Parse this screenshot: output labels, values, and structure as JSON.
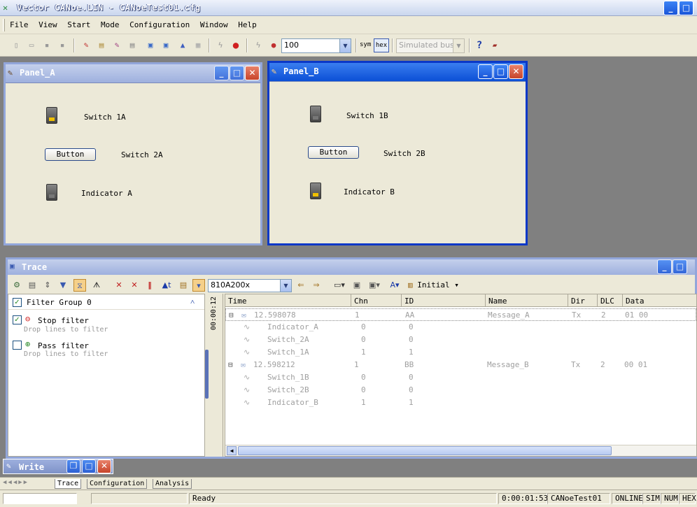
{
  "window": {
    "title": "Vector CANoe.LIN  - CANoeTest01.cfg"
  },
  "menu": [
    "File",
    "View",
    "Start",
    "Mode",
    "Configuration",
    "Window",
    "Help"
  ],
  "toolbar": {
    "zoom": "100",
    "sym": "sym",
    "hex": "hex",
    "bus": "Simulated bus"
  },
  "panel_a": {
    "title": "Panel_A",
    "switch1": "Switch 1A",
    "button": "Button",
    "switch2": "Switch 2A",
    "indicator": "Indicator A"
  },
  "panel_b": {
    "title": "Panel_B",
    "switch1": "Switch 1B",
    "button": "Button",
    "switch2": "Switch 2B",
    "indicator": "Indicator B"
  },
  "trace": {
    "title": "Trace",
    "filter_value": "810A200x",
    "view_mode": "Initial",
    "time_scale": "00:00:12",
    "filter_group": "Filter Group 0",
    "stop_filter": "Stop filter",
    "stop_hint": "Drop lines to filter",
    "pass_filter": "Pass filter",
    "pass_hint": "Drop lines to filter",
    "columns": [
      "Time",
      "Chn",
      "ID",
      "Name",
      "Dir",
      "DLC",
      "Data"
    ],
    "rows": [
      {
        "time": "12.598078",
        "chn": "1",
        "id": "AA",
        "name": "Message_A",
        "dir": "Tx",
        "dlc": "2",
        "data": "01 00"
      },
      {
        "time": "Indicator_A",
        "chn": "0",
        "id": "0",
        "name": "",
        "dir": "",
        "dlc": "",
        "data": ""
      },
      {
        "time": "Switch_2A",
        "chn": "0",
        "id": "0",
        "name": "",
        "dir": "",
        "dlc": "",
        "data": ""
      },
      {
        "time": "Switch_1A",
        "chn": "1",
        "id": "1",
        "name": "",
        "dir": "",
        "dlc": "",
        "data": ""
      },
      {
        "time": "12.598212",
        "chn": "1",
        "id": "BB",
        "name": "Message_B",
        "dir": "Tx",
        "dlc": "2",
        "data": "00 01"
      },
      {
        "time": "Switch_1B",
        "chn": "0",
        "id": "0",
        "name": "",
        "dir": "",
        "dlc": "",
        "data": ""
      },
      {
        "time": "Switch_2B",
        "chn": "0",
        "id": "0",
        "name": "",
        "dir": "",
        "dlc": "",
        "data": ""
      },
      {
        "time": "Indicator_B",
        "chn": "1",
        "id": "1",
        "name": "",
        "dir": "",
        "dlc": "",
        "data": ""
      }
    ]
  },
  "write": {
    "title": "Write"
  },
  "tabs": [
    "Trace",
    "Configuration",
    "Analysis"
  ],
  "status": {
    "ready": "Ready",
    "time": "0:00:01:53",
    "config": "CANoeTest01",
    "online": "ONLINE",
    "sim": "SIM",
    "num": "NUM",
    "hex": "HEX"
  }
}
